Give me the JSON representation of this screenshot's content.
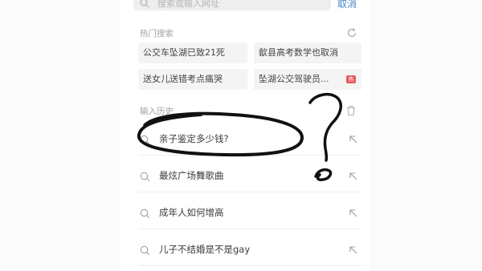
{
  "search": {
    "placeholder": "搜索或输入网址",
    "cancel_label": "取消"
  },
  "hot": {
    "title": "热门搜索",
    "items": [
      {
        "label": "公交车坠湖已致21死"
      },
      {
        "label": "歙县高考数学也取消"
      },
      {
        "label": "送女儿送错考点痛哭"
      },
      {
        "label": "坠湖公交驾驶员...",
        "badge": "热"
      }
    ]
  },
  "history": {
    "title": "输入历史",
    "items": [
      {
        "label": "亲子鉴定多少钱?"
      },
      {
        "label": "最炫广场舞歌曲"
      },
      {
        "label": "成年人如何增高"
      },
      {
        "label": "儿子不结婚是不是gay"
      }
    ]
  },
  "colors": {
    "accent": "#4a86c5",
    "hot_badge": "#e4585b",
    "chip_bg": "#f4f4f4"
  }
}
